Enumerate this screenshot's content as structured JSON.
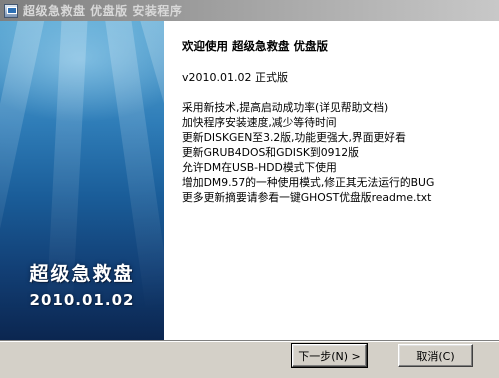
{
  "window": {
    "title": "超级急救盘 优盘版 安装程序"
  },
  "sidebar": {
    "title": "超级急救盘",
    "date": "2010.01.02"
  },
  "main": {
    "heading": "欢迎使用 超级急救盘 优盘版",
    "version": "v2010.01.02 正式版",
    "notes": [
      "采用新技术,提高启动成功率(详见帮助文档)",
      "加快程序安装速度,减少等待时间",
      "更新DISKGEN至3.2版,功能更强大,界面更好看",
      "更新GRUB4DOS和GDISK到0912版",
      "允许DM在USB-HDD模式下使用",
      "增加DM9.57的一种使用模式,修正其无法运行的BUG",
      "更多更新摘要请参看一键GHOST优盘版readme.txt"
    ]
  },
  "buttons": {
    "next": "下一步(N) >",
    "cancel": "取消(C)"
  }
}
